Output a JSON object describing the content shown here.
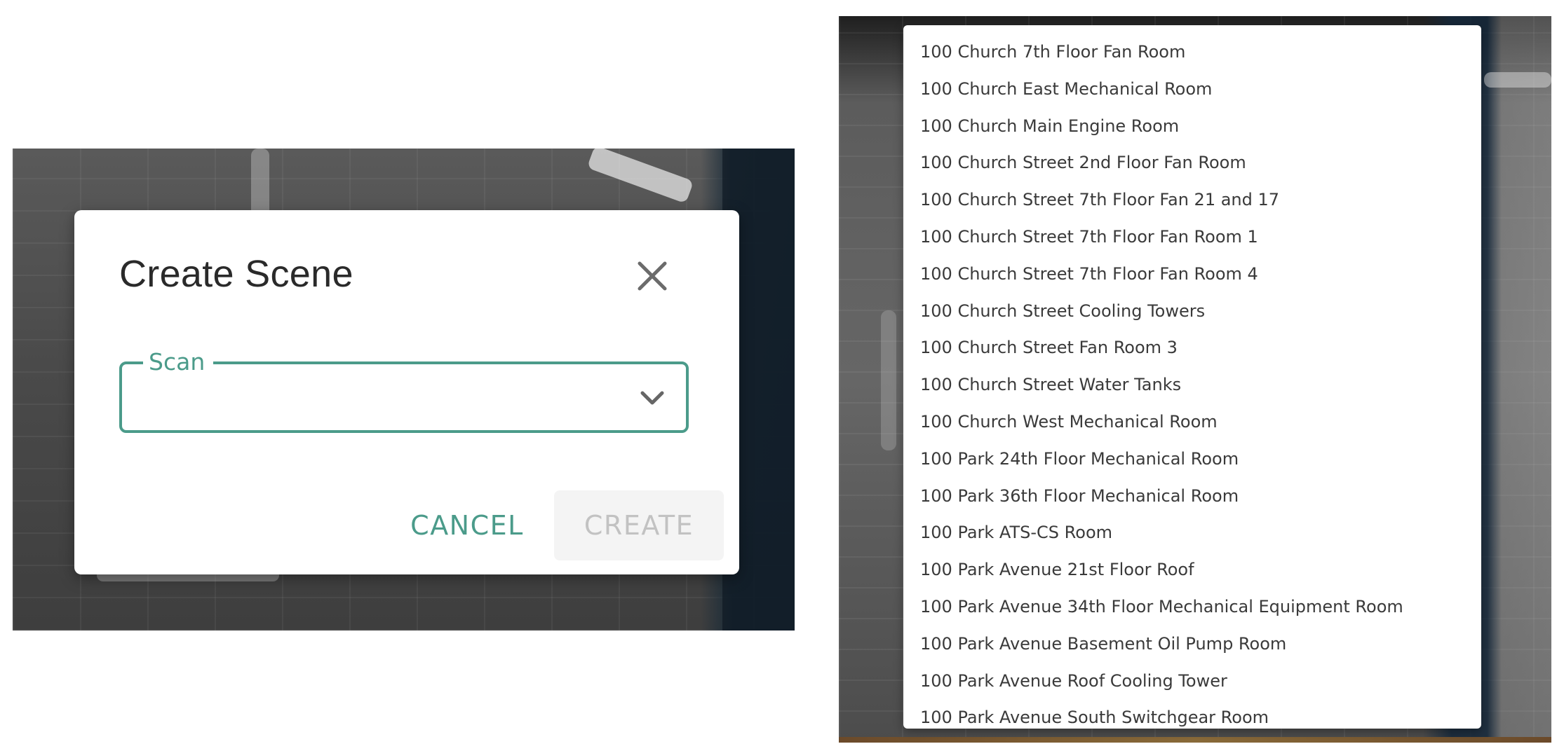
{
  "dialog": {
    "title": "Create Scene",
    "scan_field": {
      "label": "Scan",
      "value": ""
    },
    "cancel_label": "CANCEL",
    "create_label": "CREATE"
  },
  "dropdown": {
    "items": [
      "100 Church 7th Floor Fan Room",
      "100 Church East Mechanical Room",
      "100 Church Main Engine Room",
      "100 Church Street 2nd Floor Fan Room",
      "100 Church Street 7th Floor Fan 21 and 17",
      "100 Church Street 7th Floor Fan Room 1",
      "100 Church Street 7th Floor Fan Room 4",
      "100 Church Street Cooling Towers",
      "100 Church Street Fan Room 3",
      "100 Church Street Water Tanks",
      "100 Church West Mechanical Room",
      "100 Park 24th Floor Mechanical Room",
      "100 Park 36th Floor Mechanical Room",
      "100 Park ATS-CS Room",
      "100 Park Avenue 21st Floor Roof",
      "100 Park Avenue 34th Floor Mechanical Equipment Room",
      "100 Park Avenue Basement Oil Pump Room",
      "100 Park Avenue Roof Cooling Tower",
      "100 Park Avenue South Switchgear Room"
    ]
  },
  "icons": {
    "close": "close-icon",
    "expand": "chevron-down-icon"
  },
  "colors": {
    "accent": "#4b9b8a",
    "disabled_text": "#c2c2c2",
    "disabled_bg": "#f4f4f4"
  }
}
